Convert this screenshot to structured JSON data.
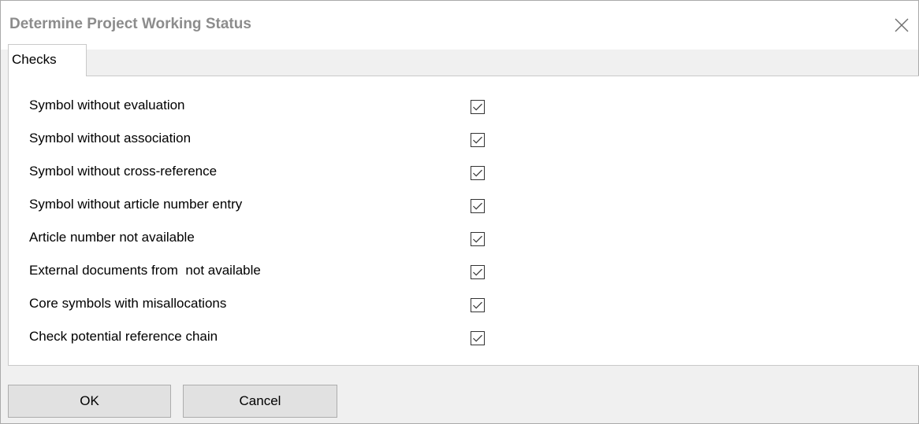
{
  "window": {
    "title": "Determine Project Working Status",
    "close_icon": "close-icon"
  },
  "tabs": [
    {
      "label": "Checks",
      "selected": true
    }
  ],
  "checks": [
    {
      "label": "Symbol without evaluation",
      "checked": true
    },
    {
      "label": "Symbol without association",
      "checked": true
    },
    {
      "label": "Symbol without cross-reference",
      "checked": true
    },
    {
      "label": "Symbol without article number entry",
      "checked": true
    },
    {
      "label": "Article number not available",
      "checked": true
    },
    {
      "label": "External documents from  not available",
      "checked": true
    },
    {
      "label": "Core symbols with misallocations",
      "checked": true
    },
    {
      "label": "Check potential reference chain",
      "checked": true
    }
  ],
  "buttons": {
    "ok_label": "OK",
    "cancel_label": "Cancel"
  },
  "colors": {
    "dialog_background": "#f0f0f0",
    "panel_background": "#ffffff",
    "title_text": "#8c8c8c",
    "button_background": "#e1e1e1",
    "checkbox_border": "#333333"
  }
}
